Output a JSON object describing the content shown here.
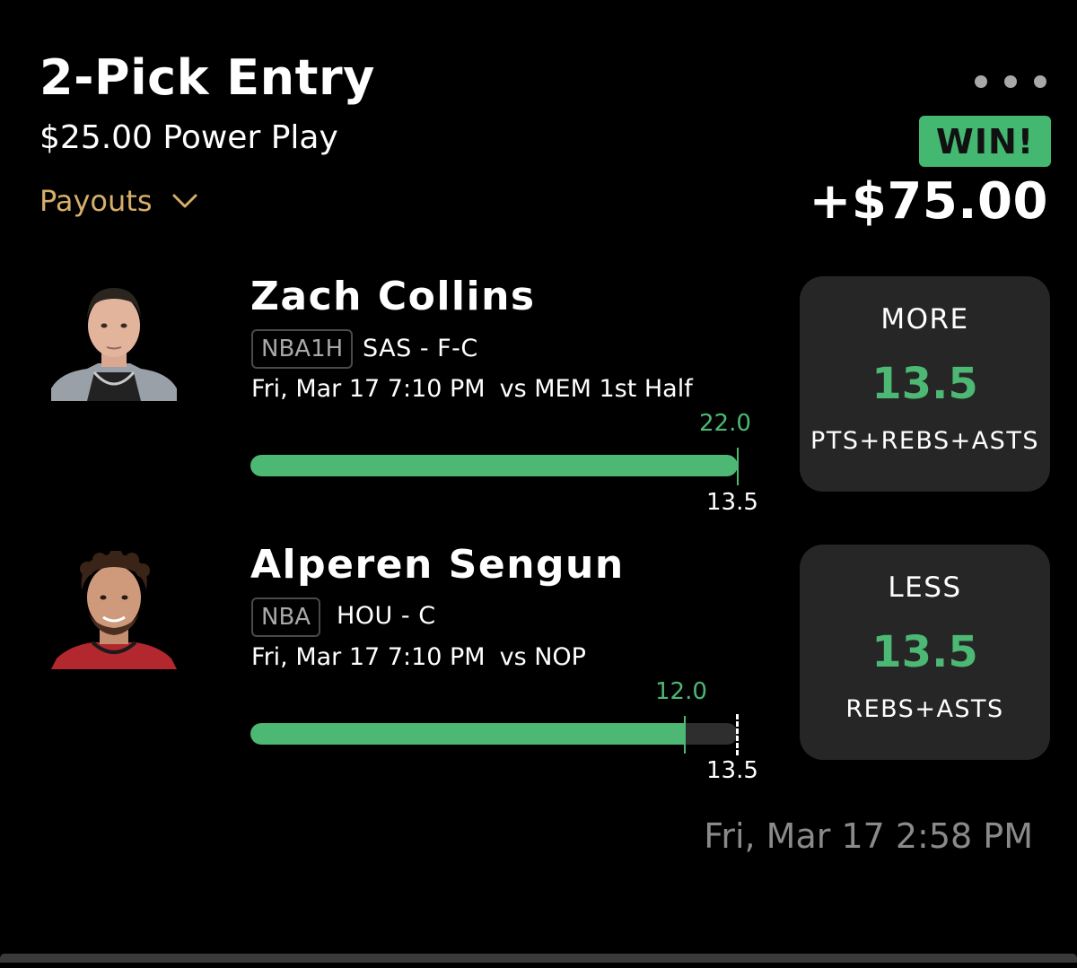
{
  "entry": {
    "title": "2-Pick Entry",
    "subtitle": "$25.00 Power Play",
    "payouts_label": "Payouts",
    "result_badge": "WIN!",
    "result_amount": "+$75.00",
    "timestamp": "Fri, Mar 17 2:58 PM"
  },
  "colors": {
    "accent_green": "#4cb874",
    "payouts_gold": "#d6ae6b",
    "background": "#000000",
    "card": "#262626"
  },
  "picks": [
    {
      "player_name": "Zach Collins",
      "league": "NBA1H",
      "team_position": "SAS - F-C",
      "game_time": "Fri, Mar 17 7:10 PM",
      "opponent": "vs MEM 1st Half",
      "actual_value": "22.0",
      "line_value": "13.5",
      "progress_fraction": 1.0,
      "direction": "MORE",
      "line": "13.5",
      "stat": "PTS+REBS+ASTS",
      "avatar_icon": "player-headshot-icon"
    },
    {
      "player_name": "Alperen Sengun",
      "league": "NBA",
      "team_position": "HOU - C",
      "game_time": "Fri, Mar 17 7:10 PM",
      "opponent": "vs NOP",
      "actual_value": "12.0",
      "line_value": "13.5",
      "progress_fraction": 0.889,
      "direction": "LESS",
      "line": "13.5",
      "stat": "REBS+ASTS",
      "avatar_icon": "player-headshot-icon"
    }
  ]
}
